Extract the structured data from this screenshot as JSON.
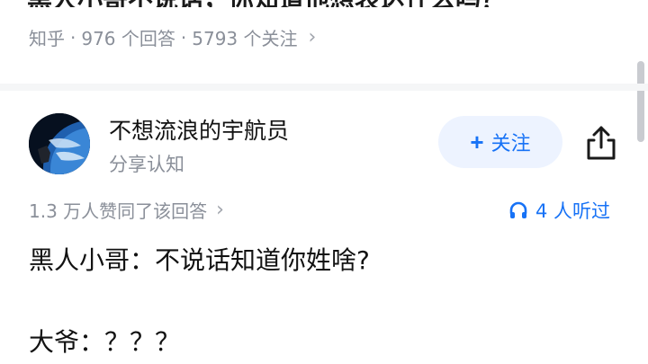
{
  "question": {
    "title": "黑人小哥不说话，你知道他想表达什么吗？",
    "source": "知乎",
    "answers": "976 个回答",
    "followers": "5793 个关注"
  },
  "answer": {
    "author_name": "不想流浪的宇航员",
    "author_desc": "分享认知",
    "follow_label": "关注",
    "likes_text": "1.3 万人赞同了该回答",
    "listened_text": "4 人听过",
    "content": [
      "黑人小哥：不说话知道你姓啥?",
      "大爷：？？？"
    ]
  },
  "colors": {
    "accent": "#1772f6",
    "follow_bg": "#edf3ff",
    "meta_gray": "#8a8f99",
    "divider": "#f5f6f7"
  },
  "icons": [
    "chevron-right-icon",
    "plus-icon",
    "share-icon",
    "headphones-icon"
  ]
}
